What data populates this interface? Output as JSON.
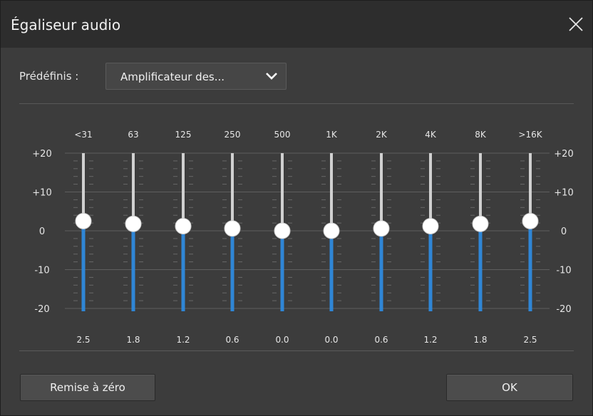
{
  "window": {
    "title": "Égaliseur audio",
    "close_icon": "close-icon"
  },
  "preset": {
    "label": "Prédéfinis :",
    "value": "Amplificateur des...",
    "chevron_icon": "chevron-down-icon"
  },
  "equalizer": {
    "scale_left": [
      "+20",
      "+10",
      "0",
      "-10",
      "-20"
    ],
    "scale_right": [
      "+20",
      "+10",
      "0",
      "-10",
      "-20"
    ],
    "range": [
      -20,
      20
    ],
    "fill_color": "#2f86d6",
    "track_color": "#d0d0d0",
    "knob_color": "#ffffff",
    "bands": [
      {
        "label": "<31",
        "value": 2.5,
        "value_text": "2.5"
      },
      {
        "label": "63",
        "value": 1.8,
        "value_text": "1.8"
      },
      {
        "label": "125",
        "value": 1.2,
        "value_text": "1.2"
      },
      {
        "label": "250",
        "value": 0.6,
        "value_text": "0.6"
      },
      {
        "label": "500",
        "value": 0.0,
        "value_text": "0.0"
      },
      {
        "label": "1K",
        "value": 0.0,
        "value_text": "0.0"
      },
      {
        "label": "2K",
        "value": 0.6,
        "value_text": "0.6"
      },
      {
        "label": "4K",
        "value": 1.2,
        "value_text": "1.2"
      },
      {
        "label": "8K",
        "value": 1.8,
        "value_text": "1.8"
      },
      {
        "label": ">16K",
        "value": 2.5,
        "value_text": "2.5"
      }
    ]
  },
  "buttons": {
    "reset": "Remise à zéro",
    "ok": "OK"
  }
}
